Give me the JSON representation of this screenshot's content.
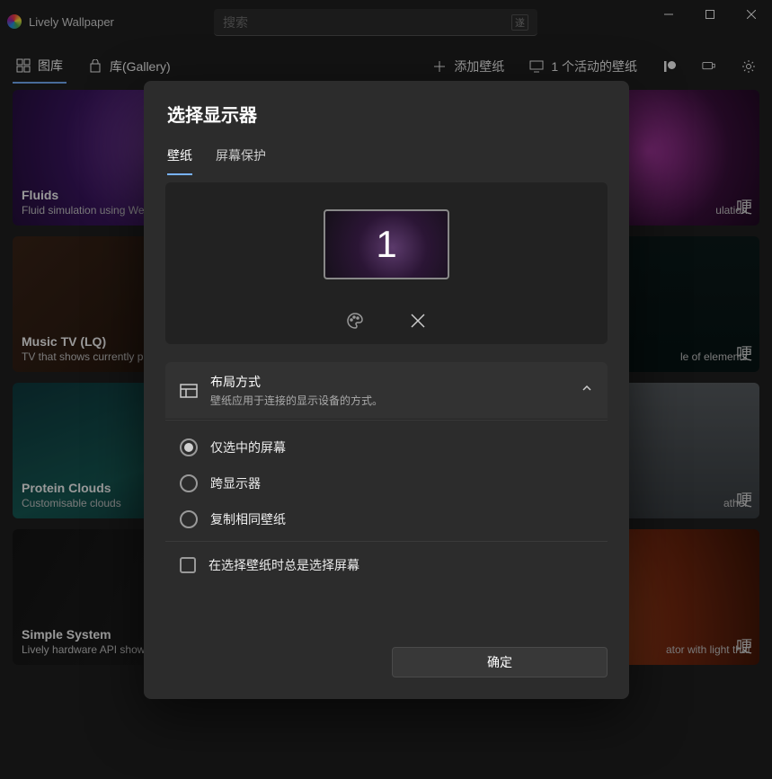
{
  "app": {
    "title": "Lively Wallpaper"
  },
  "search": {
    "placeholder": "搜索",
    "kbd": "遂"
  },
  "toolbar": {
    "library": "图库",
    "gallery": "库(Gallery)",
    "add_wallpaper": "添加壁纸",
    "active_wallpapers": "1 个活动的壁纸"
  },
  "cards": {
    "fluids": {
      "title": "Fluids",
      "desc": "Fluid simulation using WebGL. Responds to system audio & cursor."
    },
    "jelly": {
      "desc_tail": "ulation.",
      "badge": "哽"
    },
    "tv": {
      "title": "Music TV (LQ)",
      "desc": "TV that shows currently playing…"
    },
    "periodic": {
      "desc_tail": "le of elements.",
      "badge": "哽"
    },
    "clouds": {
      "title": "Protein Clouds",
      "desc": "Customisable clouds"
    },
    "rain": {
      "desc_tail": "ather.",
      "badge": "哽"
    },
    "system": {
      "title": "Simple System",
      "desc": "Lively hardware API showcase"
    },
    "fire": {
      "desc_tail": "ator with light that",
      "badge": "哽"
    }
  },
  "modal": {
    "title": "选择显示器",
    "tab_wallpaper": "壁纸",
    "tab_screensaver": "屏幕保护",
    "monitor_number": "1",
    "layout_title": "布局方式",
    "layout_desc": "壁纸应用于连接的显示设备的方式。",
    "radio_selected_only": "仅选中的屏幕",
    "radio_span": "跨显示器",
    "radio_duplicate": "复制相同壁纸",
    "checkbox_always_select": "在选择壁纸时总是选择屏幕",
    "ok": "确定"
  }
}
